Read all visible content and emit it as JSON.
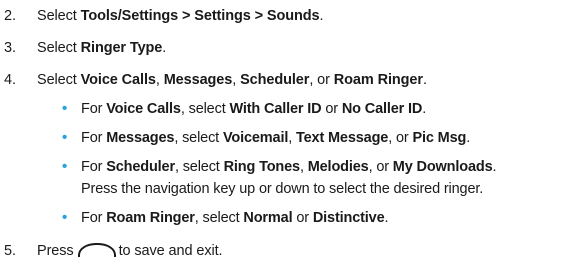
{
  "steps": [
    {
      "num": "2.",
      "parts": [
        "Select ",
        "Tools/Settings > Settings > Sounds",
        "."
      ]
    },
    {
      "num": "3.",
      "parts": [
        "Select ",
        "Ringer Type",
        "."
      ]
    },
    {
      "num": "4.",
      "parts": [
        "Select ",
        "Voice Calls",
        ", ",
        "Messages",
        ", ",
        "Scheduler",
        ", or ",
        "Roam Ringer",
        "."
      ]
    },
    {
      "num": "5.",
      "before": "Press",
      "after": "to save and exit.",
      "icon": "ok-key-icon"
    }
  ],
  "bullets": [
    {
      "parts": [
        "For ",
        "Voice Calls",
        ", select ",
        "With Caller ID",
        " or ",
        "No Caller ID",
        "."
      ]
    },
    {
      "parts": [
        "For ",
        "Messages",
        ", select ",
        "Voicemail",
        ", ",
        "Text Message",
        ", or ",
        "Pic Msg",
        "."
      ]
    },
    {
      "parts": [
        "For ",
        "Scheduler",
        ", select ",
        "Ring Tones",
        ", ",
        "Melodies",
        ", or ",
        "My Downloads",
        "."
      ],
      "line2": "Press the navigation key up or down to select the desired ringer."
    },
    {
      "parts": [
        "For ",
        "Roam Ringer",
        ", select ",
        "Normal",
        " or ",
        "Distinctive",
        "."
      ]
    }
  ],
  "bullet_symbol": "•",
  "colors": {
    "text": "#1a1a1a",
    "bullet": "#2aa3dc"
  }
}
